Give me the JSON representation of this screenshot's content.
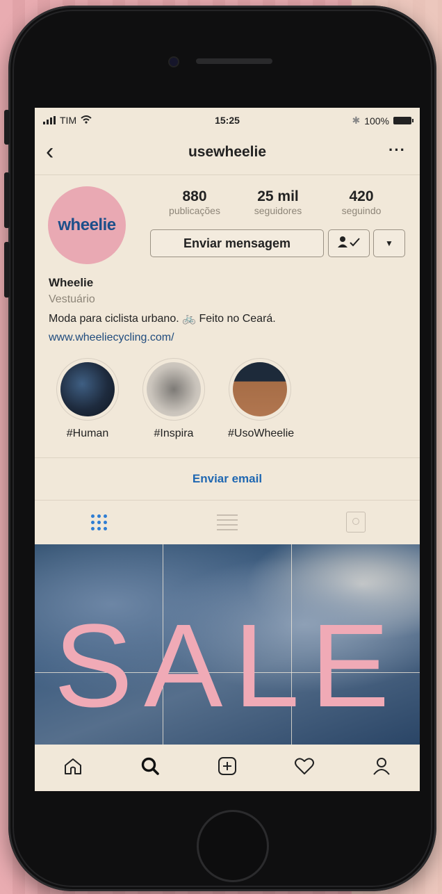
{
  "status_bar": {
    "carrier": "TIM",
    "time": "15:25",
    "battery": "100%"
  },
  "nav": {
    "back_icon": "chevron-left-icon",
    "username": "usewheelie",
    "more_icon": "ellipsis-icon"
  },
  "profile": {
    "avatar_text": "wheelie",
    "stats": [
      {
        "value": "880",
        "label": "publicações"
      },
      {
        "value": "25 mil",
        "label": "seguidores"
      },
      {
        "value": "420",
        "label": "seguindo"
      }
    ],
    "message_button": "Enviar mensagem",
    "follow_icon": "person-check-icon",
    "dropdown_icon": "caret-down-icon",
    "name": "Wheelie",
    "category": "Vestuário",
    "bio": "Moda para ciclista urbano. 🚲 Feito no Ceará.",
    "website": "www.wheeliecycling.com/"
  },
  "highlights": [
    {
      "label": "#Human"
    },
    {
      "label": "#Inspira"
    },
    {
      "label": "#UsoWheelie"
    }
  ],
  "contact": {
    "email_button": "Enviar email"
  },
  "tabs": [
    {
      "name": "grid",
      "icon": "grid-icon",
      "active": true
    },
    {
      "name": "list",
      "icon": "list-icon",
      "active": false
    },
    {
      "name": "tagged",
      "icon": "tagged-icon",
      "active": false
    }
  ],
  "post": {
    "overlay_text": "SALE"
  },
  "colors": {
    "accent": "#1f67b1",
    "background": "#f1e8d9",
    "brand_pink": "#e9a9b3",
    "brand_blue": "#1d4f8a"
  },
  "tab_bar": [
    {
      "icon": "home-icon"
    },
    {
      "icon": "search-icon"
    },
    {
      "icon": "add-post-icon"
    },
    {
      "icon": "heart-icon"
    },
    {
      "icon": "profile-icon"
    }
  ]
}
